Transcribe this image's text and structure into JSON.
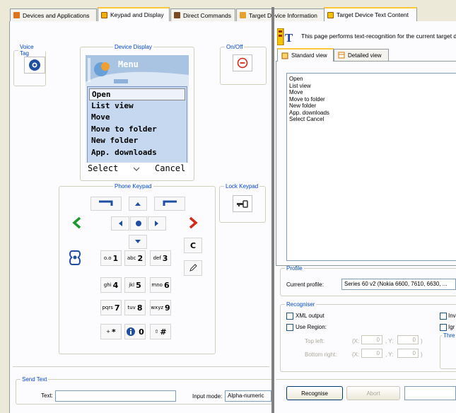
{
  "tabs": [
    {
      "label": "Devices and Applications",
      "icon": "devices-icon"
    },
    {
      "label": "Keypad and Display",
      "icon": "keypad-display-icon"
    },
    {
      "label": "Direct Commands",
      "icon": "direct-commands-icon"
    },
    {
      "label": "Target Device Information",
      "icon": "device-info-icon"
    },
    {
      "label": "Target Device Text Content",
      "icon": "text-content-icon"
    }
  ],
  "left": {
    "voice_tag": {
      "legend": "Voice Tag"
    },
    "device_display": {
      "legend": "Device Display",
      "header_title": "Menu",
      "menu_items": [
        "Open",
        "List view",
        "Move",
        "Move to folder",
        "New folder",
        "App. downloads"
      ],
      "left_softkey": "Select",
      "right_softkey": "Cancel"
    },
    "on_off": {
      "legend": "On/Off"
    },
    "phone_keypad": {
      "legend": "Phone Keypad",
      "keys": [
        {
          "sub": "o.o",
          "main": "1"
        },
        {
          "sub": "abc",
          "main": "2"
        },
        {
          "sub": "def",
          "main": "3"
        },
        {
          "sub": "ghi",
          "main": "4"
        },
        {
          "sub": "jkl",
          "main": "5"
        },
        {
          "sub": "mno",
          "main": "6"
        },
        {
          "sub": "pqrs",
          "main": "7"
        },
        {
          "sub": "tuv",
          "main": "8"
        },
        {
          "sub": "wxyz",
          "main": "9"
        },
        {
          "sub": "+",
          "main": "*"
        },
        {
          "sub": "",
          "main": "0"
        },
        {
          "sub": "⇧",
          "main": "#"
        }
      ],
      "clear_key": "C"
    },
    "lock_keypad": {
      "legend": "Lock Keypad"
    },
    "send_text": {
      "legend": "Send Text",
      "text_label": "Text:",
      "text_value": "",
      "input_mode_label": "Input mode:",
      "input_mode_value": "Alpha-numeric"
    }
  },
  "right": {
    "description": "This page performs text-recognition for the current target d",
    "subtabs": [
      {
        "label": "Standard view"
      },
      {
        "label": "Detailed view"
      }
    ],
    "recognized_text": [
      "Open",
      "List view",
      "Move",
      "Move to folder",
      "New folder",
      "App. downloads",
      "Select Cancel"
    ],
    "profile": {
      "legend": "Profile",
      "current_profile_label": "Current profile:",
      "current_profile_value": "Series 60 v2 (Nokia 6600, 7610, 6630, ..."
    },
    "recogniser": {
      "legend": "Recogniser",
      "xml_output": "XML output",
      "use_region": "Use Region:",
      "top_left": "Top left:",
      "bottom_right": "Bottom right:",
      "x_label": "(X:",
      "y_label": ", Y:",
      "close_paren": ")",
      "tl_x": "0",
      "tl_y": "0",
      "br_x": "0",
      "br_y": "0",
      "inv_label": "Inv",
      "ign_label": "Igr",
      "thresh_label": "Thre"
    },
    "buttons": {
      "recognise": "Recognise",
      "abort": "Abort"
    }
  },
  "colors": {
    "accent_orange": "#ffc83c",
    "legend_blue": "#0046d5",
    "arrow_green": "#1a9a2a",
    "arrow_red": "#d42a1a",
    "key_blue": "#1f4ea3",
    "menu_highlight": "#c6d8ef"
  }
}
